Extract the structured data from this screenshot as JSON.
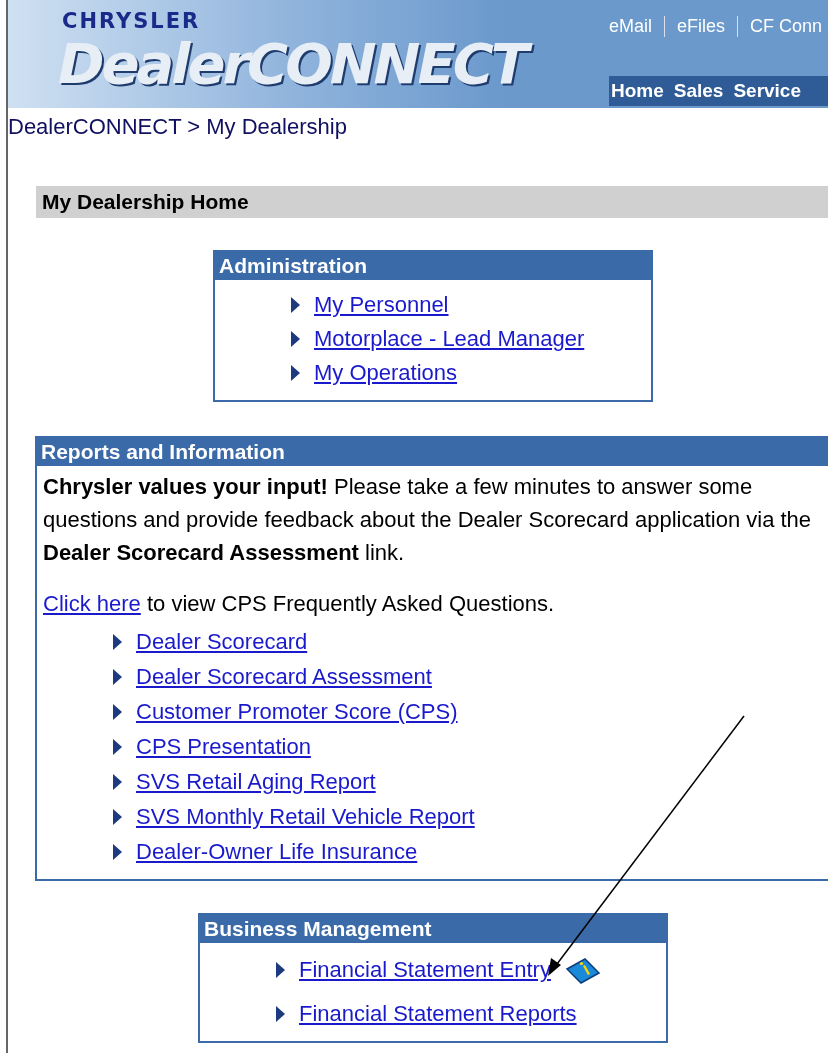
{
  "header": {
    "brand": "CHRYSLER",
    "product": [
      "Dealer",
      "CONNECT"
    ],
    "top_links": [
      "eMail",
      "eFiles",
      "CF Conn"
    ],
    "nav": [
      "Home",
      "Sales",
      "Service"
    ]
  },
  "breadcrumb": "DealerCONNECT > My Dealership",
  "section_title": "My Dealership Home",
  "panels": [
    {
      "kind": "links",
      "title": "Administration",
      "items": [
        {
          "label": "My Personnel",
          "info": false
        },
        {
          "label": "Motorplace - Lead Manager",
          "info": false
        },
        {
          "label": "My Operations",
          "info": false
        }
      ]
    },
    {
      "kind": "reports",
      "title": "Reports and Information",
      "intro": "**Chrysler values your input!** Please take a few minutes to answer some questions and provide feedback about the Dealer Scorecard application via the **Dealer Scorecard Assessment** link.",
      "faq": {
        "link": "Click here",
        "text": " to view CPS Frequently Asked Questions."
      },
      "items": [
        {
          "label": "Dealer Scorecard",
          "info": false
        },
        {
          "label": "Dealer Scorecard Assessment",
          "info": false
        },
        {
          "label": "Customer Promoter Score (CPS)",
          "info": false
        },
        {
          "label": "CPS Presentation",
          "info": false
        },
        {
          "label": "SVS Retail Aging Report",
          "info": false
        },
        {
          "label": "SVS Monthly Retail Vehicle Report",
          "info": false
        },
        {
          "label": "Dealer-Owner Life Insurance",
          "info": false
        }
      ]
    },
    {
      "kind": "links",
      "title": "Business Management",
      "items": [
        {
          "label": "Financial Statement Entry",
          "info": true
        },
        {
          "label": "Financial Statement Reports",
          "info": false
        }
      ]
    }
  ]
}
